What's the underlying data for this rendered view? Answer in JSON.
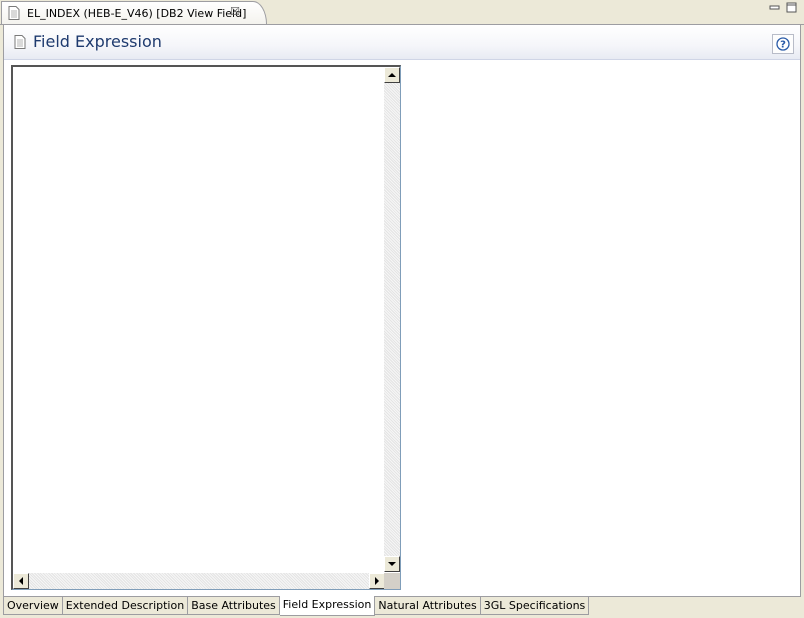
{
  "editor_tab": {
    "title": "EL_INDEX (HEB-E_V46)  [DB2 View Field]",
    "close_symbol": "☒",
    "icon": "document-icon"
  },
  "window_controls": {
    "minimize_icon": "minimize-icon",
    "maximize_icon": "maximize-icon"
  },
  "form": {
    "title": "Field Expression",
    "title_icon": "document-icon",
    "help_icon": "help-icon",
    "expression_text": ""
  },
  "page_tabs": [
    {
      "label": "Overview",
      "active": false
    },
    {
      "label": "Extended Description",
      "active": false
    },
    {
      "label": "Base Attributes",
      "active": false
    },
    {
      "label": "Field Expression",
      "active": true
    },
    {
      "label": "Natural Attributes",
      "active": false
    },
    {
      "label": "3GL Specifications",
      "active": false
    }
  ],
  "colors": {
    "title_text": "#1e3a6e",
    "background": "#ece9d8"
  }
}
